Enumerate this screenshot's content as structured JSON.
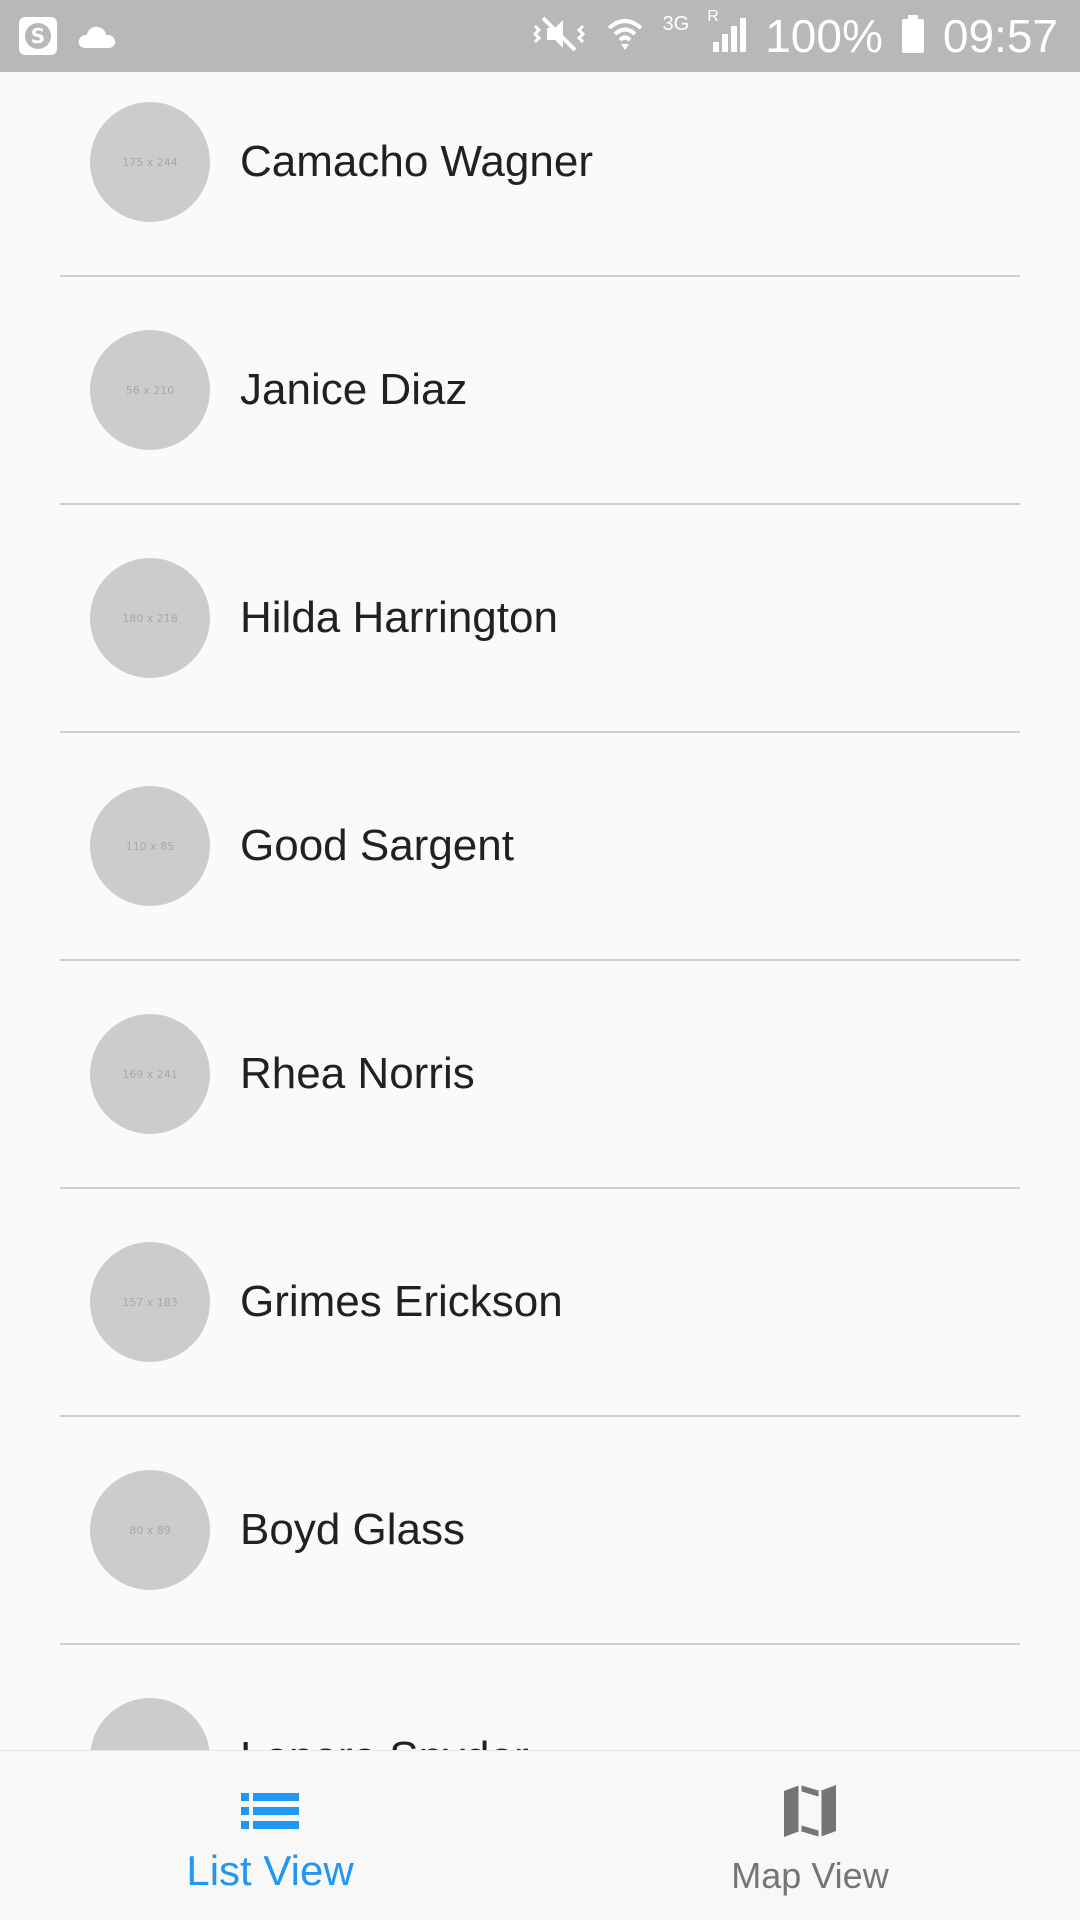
{
  "status_bar": {
    "battery": "100%",
    "time": "09:57",
    "network": "3G",
    "roaming": "R"
  },
  "contacts": [
    {
      "name": "Camacho Wagner",
      "avatar_text": "175 x 244"
    },
    {
      "name": "Janice Diaz",
      "avatar_text": "56 x 210"
    },
    {
      "name": "Hilda Harrington",
      "avatar_text": "180 x 218"
    },
    {
      "name": "Good Sargent",
      "avatar_text": "110 x 85"
    },
    {
      "name": "Rhea Norris",
      "avatar_text": "169 x 241"
    },
    {
      "name": "Grimes Erickson",
      "avatar_text": "157 x 183"
    },
    {
      "name": "Boyd Glass",
      "avatar_text": "80 x 89"
    },
    {
      "name": "Lenore Snyder",
      "avatar_text": ""
    }
  ],
  "bottom_nav": {
    "tabs": [
      {
        "label": "List View",
        "icon": "list-icon",
        "active": true
      },
      {
        "label": "Map View",
        "icon": "map-icon",
        "active": false
      }
    ]
  },
  "colors": {
    "accent": "#2196f3",
    "status_bar": "#b8b8b8",
    "background": "#fafafa",
    "avatar": "#cccccc",
    "divider": "#cfcfcf"
  }
}
